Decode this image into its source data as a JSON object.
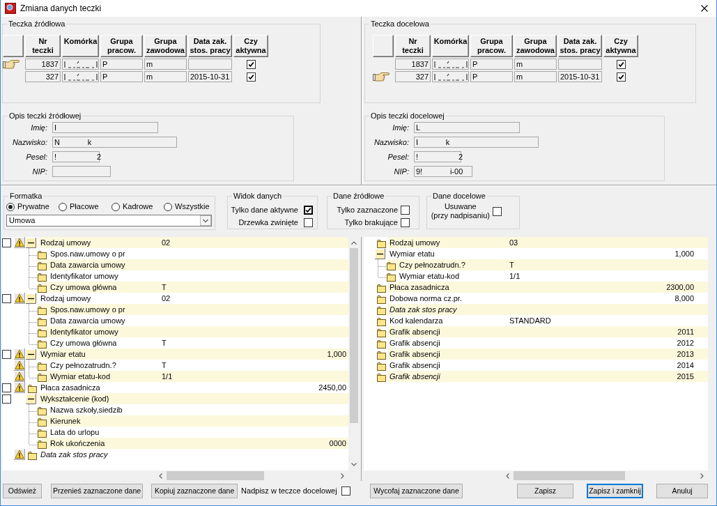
{
  "window": {
    "title": "Zmiana danych teczki"
  },
  "source_folder": {
    "title": "Teczka źródłowa",
    "columns": [
      "Nr\nteczki",
      "Komórka",
      "Grupa\npracow.",
      "Grupa\nzawodowa",
      "Data zak.\nstos. pracy",
      "Czy\naktywna"
    ],
    "rows": [
      {
        "selected": true,
        "nr_teczki": "1837",
        "komorka_redacted": true,
        "grupa_pracow": "P",
        "grupa_zawodowa": "m",
        "czy_aktywna": true
      },
      {
        "selected": false,
        "nr_teczki": "327",
        "komorka_redacted": true,
        "grupa_pracow": "P",
        "grupa_zawodowa": "m",
        "data_zak_stos_pracy": "2015-10-31",
        "czy_aktywna": true
      }
    ]
  },
  "target_folder": {
    "title": "Teczka docelowa",
    "columns": [
      "Nr\nteczki",
      "Komórka",
      "Grupa\npracow.",
      "Grupa\nzawodowa",
      "Data zak.\nstos. pracy",
      "Czy\naktywna"
    ],
    "rows": [
      {
        "selected": false,
        "nr_teczki": "1837",
        "komorka_redacted": true,
        "grupa_pracow": "P",
        "grupa_zawodowa": "m",
        "czy_aktywna": true
      },
      {
        "selected": true,
        "nr_teczki": "327",
        "komorka_redacted": true,
        "grupa_pracow": "P",
        "grupa_zawodowa": "m",
        "data_zak_stos_pracy": "2015-10-31",
        "czy_aktywna": true
      }
    ]
  },
  "source_description": {
    "title": "Opis teczki źródłowej",
    "fields": [
      {
        "label": "Imię:",
        "value": "I"
      },
      {
        "label": "Nazwisko:",
        "value": "N             k"
      },
      {
        "label": "Pesel:",
        "value": "!                   2"
      },
      {
        "label": "NIP:"
      }
    ]
  },
  "target_description": {
    "title": "Opis teczki docelowej",
    "fields": [
      {
        "label": "Imię:",
        "value": "L"
      },
      {
        "label": "Nazwisko:",
        "value": "I             k"
      },
      {
        "label": "Pesel:",
        "value": "!                   2"
      },
      {
        "label": "NIP:",
        "value": "9!             i-00"
      }
    ]
  },
  "formatka": {
    "title": "Formatka",
    "options": [
      {
        "label": "Prywatne",
        "selected": true
      },
      {
        "label": "Płacowe",
        "selected": false
      },
      {
        "label": "Kadrowe",
        "selected": false
      },
      {
        "label": "Wszystkie",
        "selected": false
      }
    ],
    "dropdown": {
      "value": "Umowa"
    }
  },
  "data_view": {
    "title": "Widok danych",
    "options": [
      {
        "label": "Tylko dane aktywne",
        "checked": true,
        "focused": true
      },
      {
        "label": "Drzewka zwinięte",
        "checked": false,
        "focused": false
      }
    ]
  },
  "source_data": {
    "title": "Dane źródłowe",
    "options": [
      {
        "label": "Tylko zaznaczone",
        "checked": false
      },
      {
        "label": "Tylko brakujące",
        "checked": false
      }
    ]
  },
  "target_data": {
    "title": "Dane docelowe",
    "options": [
      {
        "label": "Usuwane\n(przy nadpisaniu)",
        "checked": false
      }
    ]
  },
  "source_tree": {
    "nodes": [
      {
        "label": "Rodzaj umowy",
        "column_2": "02",
        "checked": false,
        "warning": true,
        "italic": false,
        "expanded": true,
        "children": [
          {
            "label": "Spos.naw.umowy o pr",
            "warning": false,
            "italic": false
          },
          {
            "label": "Data zawarcia umowy",
            "warning": false,
            "italic": false
          },
          {
            "label": "Identyfikator umowy",
            "warning": false,
            "italic": false
          },
          {
            "label": "Czy umowa główna",
            "column_2": "T",
            "warning": false,
            "italic": false
          }
        ]
      },
      {
        "label": "Rodzaj umowy",
        "column_2": "02",
        "checked": false,
        "warning": true,
        "italic": false,
        "expanded": true,
        "children": [
          {
            "label": "Spos.naw.umowy o pr",
            "warning": false,
            "italic": false
          },
          {
            "label": "Data zawarcia umowy",
            "warning": false,
            "italic": false
          },
          {
            "label": "Identyfikator umowy",
            "warning": false,
            "italic": false
          },
          {
            "label": "Czy umowa główna",
            "column_2": "T",
            "warning": false,
            "italic": false
          }
        ]
      },
      {
        "label": "Wymiar etatu",
        "column_3": "1,000",
        "checked": false,
        "warning": true,
        "italic": false,
        "expanded": true,
        "children": [
          {
            "label": "Czy pełnozatrudn.?",
            "column_2": "T",
            "warning": true,
            "italic": false
          },
          {
            "label": "Wymiar etatu-kod",
            "column_2": "1/1",
            "warning": true,
            "italic": false
          }
        ]
      },
      {
        "label": "Płaca zasadnicza",
        "column_3": "2450,00",
        "checked": false,
        "warning": true,
        "italic": false
      },
      {
        "label": "Wykształcenie (kod)",
        "checked": false,
        "warning": false,
        "italic": false,
        "expanded": true,
        "children": [
          {
            "label": "Nazwa szkoły,siedzib",
            "warning": false,
            "italic": false
          },
          {
            "label": "Kierunek",
            "warning": false,
            "italic": false
          },
          {
            "label": "Lata do urlopu",
            "warning": false,
            "italic": false
          },
          {
            "label": "Rok ukończenia",
            "column_3": "0000",
            "warning": false,
            "italic": false
          }
        ]
      },
      {
        "label": "Data zak stos pracy",
        "warning": true,
        "italic": true
      }
    ]
  },
  "target_tree": {
    "nodes": [
      {
        "label": "Rodzaj umowy",
        "column_2": "03",
        "italic": false
      },
      {
        "label": "Wymiar etatu",
        "column_3": "1,000",
        "italic": false,
        "expanded": true,
        "children": [
          {
            "label": "Czy pełnozatrudn.?",
            "column_2": "T",
            "italic": false
          },
          {
            "label": "Wymiar etatu-kod",
            "column_2": "1/1",
            "italic": false
          }
        ]
      },
      {
        "label": "Płaca zasadnicza",
        "column_3": "2300,00",
        "italic": false
      },
      {
        "label": "Dobowa norma cz.pr.",
        "column_3": "8,000",
        "italic": false
      },
      {
        "label": "Data zak stos pracy",
        "italic": true
      },
      {
        "label": "Kod kalendarza",
        "column_2": "STANDARD",
        "italic": false
      },
      {
        "label": "Grafik absencji",
        "column_3": "2011",
        "italic": false
      },
      {
        "label": "Grafik absencji",
        "column_3": "2012",
        "italic": false
      },
      {
        "label": "Grafik absencji",
        "column_3": "2013",
        "italic": false
      },
      {
        "label": "Grafik absencji",
        "column_3": "2014",
        "italic": false
      },
      {
        "label": "Grafik absencji",
        "column_3": "2015",
        "italic": true
      }
    ]
  },
  "source_actions": [
    {
      "kind": "button",
      "label": "Odśwież"
    },
    {
      "kind": "button",
      "label": "Przenieś zaznaczone dane"
    },
    {
      "kind": "button",
      "label": "Kopiuj zaznaczone dane"
    },
    {
      "kind": "checkbox",
      "label": "Nadpisz w teczce docelowej",
      "checked": false
    }
  ],
  "target_actions": [
    {
      "kind": "button",
      "label": "Wycofaj zaznaczone dane"
    }
  ],
  "dialog_buttons": [
    {
      "label": "Zapisz",
      "default": false
    },
    {
      "label": "Zapisz i zamknij",
      "default": true
    },
    {
      "label": "Anuluj",
      "default": false
    }
  ]
}
